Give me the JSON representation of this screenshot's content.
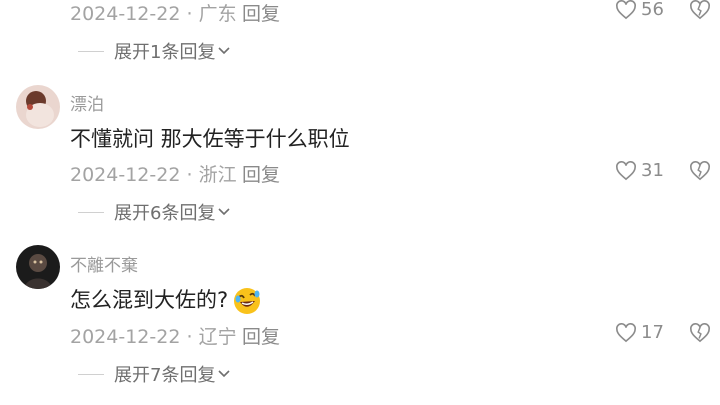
{
  "comment_top": {
    "date": "2024-12-22",
    "location": "广东",
    "reply_label": "回复",
    "likes": "56",
    "expand_label": "展开1条回复"
  },
  "comments": [
    {
      "username": "漂泊",
      "text": "不懂就问  那大佐等于什么职位",
      "date": "2024-12-22",
      "location": "浙江",
      "reply_label": "回复",
      "likes": "31",
      "expand_label": "展开6条回复"
    },
    {
      "username": "不離不棄",
      "text": "怎么混到大佐的?",
      "emoji": "rolling-laugh-emoji",
      "date": "2024-12-22",
      "location": "辽宁",
      "reply_label": "回复",
      "likes": "17",
      "expand_label": "展开7条回复"
    }
  ],
  "separator": "·",
  "icons": {
    "like": "heart-icon",
    "dislike": "broken-heart-icon",
    "expand": "chevron-down-icon"
  }
}
